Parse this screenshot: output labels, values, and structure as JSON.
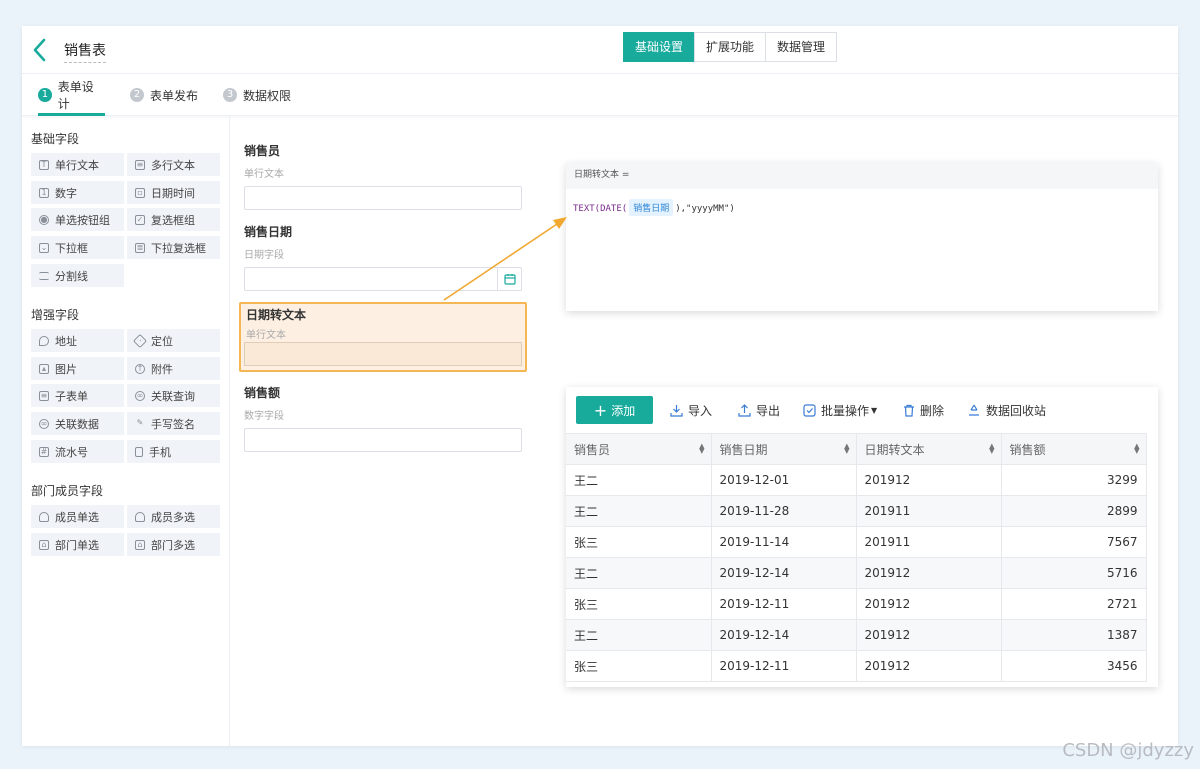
{
  "header": {
    "form_title": "销售表",
    "tabs": [
      {
        "label": "基础设置",
        "active": true
      },
      {
        "label": "扩展功能",
        "active": false
      },
      {
        "label": "数据管理",
        "active": false
      }
    ]
  },
  "steps": [
    {
      "num": "1",
      "label": "表单设计",
      "active": true
    },
    {
      "num": "2",
      "label": "表单发布",
      "active": false
    },
    {
      "num": "3",
      "label": "数据权限",
      "active": false
    }
  ],
  "sidebar": {
    "groups": [
      {
        "title": "基础字段",
        "items": [
          {
            "label": "单行文本",
            "icon": "text-icon"
          },
          {
            "label": "多行文本",
            "icon": "multiline-icon"
          },
          {
            "label": "数字",
            "icon": "number-icon"
          },
          {
            "label": "日期时间",
            "icon": "calendar-icon"
          },
          {
            "label": "单选按钮组",
            "icon": "radio-icon"
          },
          {
            "label": "复选框组",
            "icon": "checkbox-icon"
          },
          {
            "label": "下拉框",
            "icon": "dropdown-icon"
          },
          {
            "label": "下拉复选框",
            "icon": "list-icon"
          },
          {
            "label": "分割线",
            "icon": "divider-icon"
          }
        ]
      },
      {
        "title": "增强字段",
        "items": [
          {
            "label": "地址",
            "icon": "location-icon"
          },
          {
            "label": "定位",
            "icon": "locate-icon"
          },
          {
            "label": "图片",
            "icon": "image-icon"
          },
          {
            "label": "附件",
            "icon": "attachment-icon"
          },
          {
            "label": "子表单",
            "icon": "subform-icon"
          },
          {
            "label": "关联查询",
            "icon": "link-query-icon"
          },
          {
            "label": "关联数据",
            "icon": "link-data-icon"
          },
          {
            "label": "手写签名",
            "icon": "signature-icon"
          },
          {
            "label": "流水号",
            "icon": "serial-icon"
          },
          {
            "label": "手机",
            "icon": "phone-icon"
          }
        ]
      },
      {
        "title": "部门成员字段",
        "items": [
          {
            "label": "成员单选",
            "icon": "user-icon"
          },
          {
            "label": "成员多选",
            "icon": "users-icon"
          },
          {
            "label": "部门单选",
            "icon": "dept-icon"
          },
          {
            "label": "部门多选",
            "icon": "depts-icon"
          }
        ]
      }
    ]
  },
  "canvas": {
    "fields": [
      {
        "label": "销售员",
        "type": "单行文本"
      },
      {
        "label": "销售日期",
        "type": "日期字段"
      },
      {
        "label": "日期转文本",
        "type": "单行文本"
      },
      {
        "label": "销售额",
        "type": "数字字段"
      }
    ]
  },
  "formula": {
    "header": "日期转文本 =",
    "prefix": "TEXT(DATE(",
    "token": "销售日期",
    "suffix": "),\"yyyyMM\")"
  },
  "data_panel": {
    "toolbar": {
      "add": "添加",
      "import": "导入",
      "export": "导出",
      "batch": "批量操作",
      "delete": "删除",
      "recycle": "数据回收站"
    },
    "columns": [
      "销售员",
      "销售日期",
      "日期转文本",
      "销售额"
    ],
    "rows": [
      [
        "王二",
        "2019-12-01",
        "201912",
        "3299"
      ],
      [
        "王二",
        "2019-11-28",
        "201911",
        "2899"
      ],
      [
        "张三",
        "2019-11-14",
        "201911",
        "7567"
      ],
      [
        "王二",
        "2019-12-14",
        "201912",
        "5716"
      ],
      [
        "张三",
        "2019-12-11",
        "201912",
        "2721"
      ],
      [
        "王二",
        "2019-12-14",
        "201912",
        "1387"
      ],
      [
        "张三",
        "2019-12-11",
        "201912",
        "3456"
      ]
    ]
  },
  "watermark": "CSDN @jdyzzy",
  "colors": {
    "accent": "#18ab9c",
    "highlight": "#f5b754",
    "highlight_bg": "#fdf0e3"
  }
}
